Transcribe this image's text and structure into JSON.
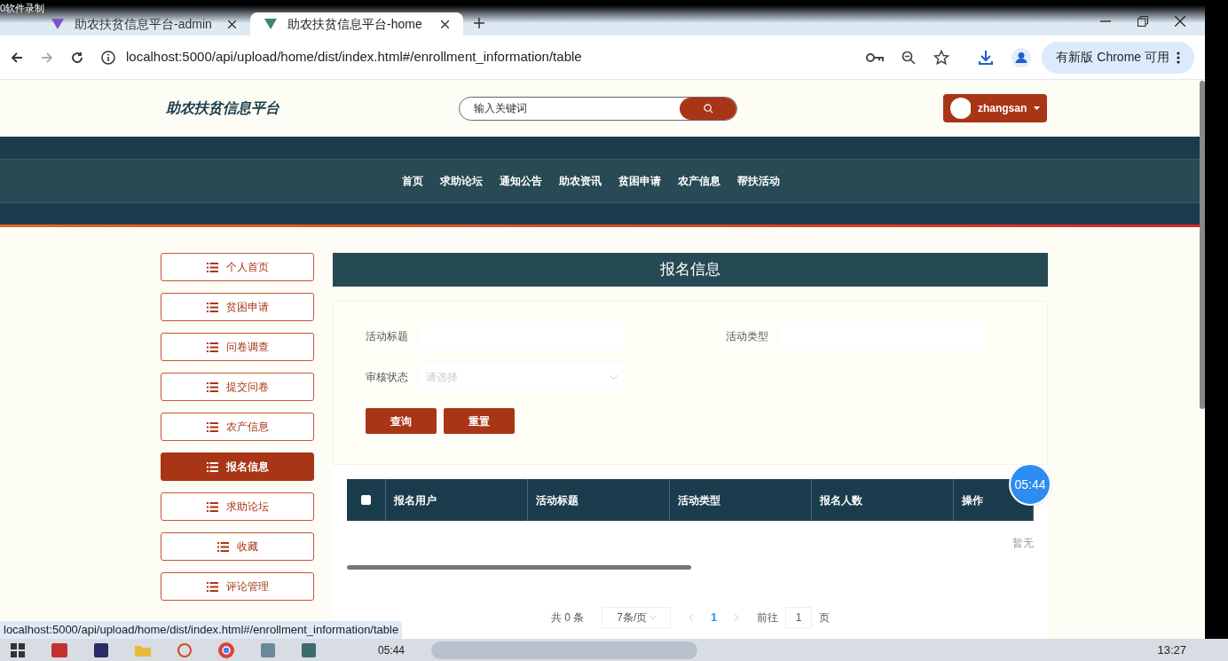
{
  "recorder": {
    "label": "0软件录制",
    "timer": "05:44"
  },
  "browser": {
    "tabs": [
      {
        "title": "助农扶贫信息平台-admin",
        "selected": false
      },
      {
        "title": "助农扶贫信息平台-home",
        "selected": true
      }
    ],
    "url": "localhost:5000/api/upload/home/dist/index.html#/enrollment_information/table",
    "update_button": "有新版 Chrome 可用",
    "status_url": "localhost:5000/api/upload/home/dist/index.html#/enrollment_information/table"
  },
  "header": {
    "logo": "助农扶贫信息平台",
    "search": {
      "placeholder": "输入关键词"
    },
    "user": "zhangsan"
  },
  "nav": [
    "首页",
    "求助论坛",
    "通知公告",
    "助农资讯",
    "贫困申请",
    "农产信息",
    "帮扶活动"
  ],
  "sidebar": [
    {
      "label": "个人首页",
      "selected": false
    },
    {
      "label": "贫困申请",
      "selected": false
    },
    {
      "label": "问卷调查",
      "selected": false
    },
    {
      "label": "提交问卷",
      "selected": false
    },
    {
      "label": "农产信息",
      "selected": false
    },
    {
      "label": "报名信息",
      "selected": true
    },
    {
      "label": "求助论坛",
      "selected": false
    },
    {
      "label": "收藏",
      "selected": false
    },
    {
      "label": "评论管理",
      "selected": false
    }
  ],
  "title": "报名信息",
  "filters": [
    {
      "label": "活动标题",
      "kind": "text"
    },
    {
      "label": "活动类型",
      "kind": "text"
    },
    {
      "label": "审核状态",
      "kind": "select",
      "placeholder": "请选择"
    }
  ],
  "buttons": [
    "查询",
    "重置"
  ],
  "table": {
    "select_all": {
      "checked": false
    },
    "columns": [
      "报名用户",
      "活动标题",
      "活动类型",
      "报名人数",
      "操作"
    ],
    "empty": "暂无"
  },
  "pagination": {
    "total": "共 0 条",
    "page_size": "7条/页",
    "pages": [
      {
        "label": "1",
        "selected": true
      }
    ],
    "goto": "前往",
    "goto_value": "1",
    "goto_suffix": "页"
  },
  "taskbar": {
    "media_time": "05:44",
    "clock": "13:27"
  }
}
